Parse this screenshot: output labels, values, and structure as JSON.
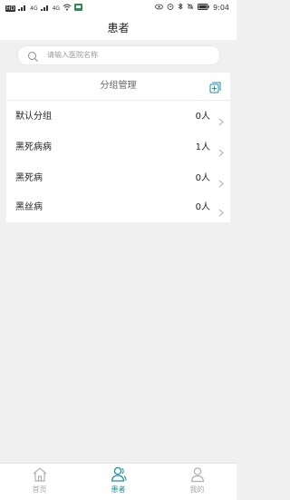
{
  "status_bar": {
    "left_labels": [
      "HD",
      "4G",
      "4G"
    ],
    "time": "9:04"
  },
  "header": {
    "title": "患者"
  },
  "search": {
    "placeholder": "请输入医院名称"
  },
  "groups_panel": {
    "title": "分组管理",
    "rows": [
      {
        "name": "默认分组",
        "count": "0人"
      },
      {
        "name": "黑死病病",
        "count": "1人"
      },
      {
        "name": "黑死病",
        "count": "0人"
      },
      {
        "name": "黑丝病",
        "count": "0人"
      }
    ]
  },
  "tabs": [
    {
      "label": "首页",
      "icon": "home-icon",
      "active": false
    },
    {
      "label": "患者",
      "icon": "patients-icon",
      "active": true
    },
    {
      "label": "我的",
      "icon": "profile-icon",
      "active": false
    }
  ],
  "colors": {
    "accent": "#1b8fa1",
    "inactive_tab": "#a8a8a8",
    "page_bg": "#f0f0f0"
  }
}
